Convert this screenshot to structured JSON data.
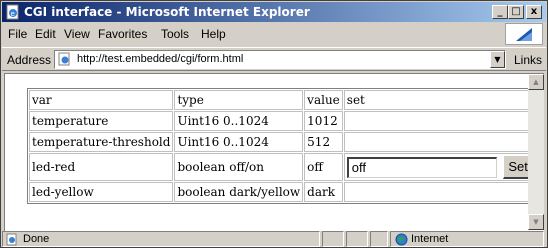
{
  "window": {
    "title": "CGI interface - Microsoft Internet Explorer",
    "minimize": "_",
    "maximize": "□",
    "close": "x"
  },
  "menu": {
    "file": "File",
    "edit": "Edit",
    "view": "View",
    "favorites": "Favorites",
    "tools": "Tools",
    "help": "Help"
  },
  "address": {
    "label": "Address",
    "url": "http://test.embedded/cgi/form.html",
    "links": "Links"
  },
  "table": {
    "headers": [
      "var",
      "type",
      "value",
      "set"
    ],
    "rows": [
      {
        "var": "temperature",
        "type": "Uint16 0..1024",
        "value": "1012"
      },
      {
        "var": "temperature-threshold",
        "type": "Uint16 0..1024",
        "value": "512"
      },
      {
        "var": "led-red",
        "type": "boolean off/on",
        "value": "off",
        "input": "off",
        "button": "Set"
      },
      {
        "var": "led-yellow",
        "type": "boolean dark/yellow",
        "value": "dark"
      }
    ]
  },
  "status": {
    "text": "Done",
    "zone": "Internet"
  },
  "colors": {
    "titlebar_start": "#0a246a",
    "titlebar_end": "#a6caf0",
    "chrome": "#d4d0c8"
  },
  "icons": [
    "ie-page-icon",
    "ie-logo-icon",
    "globe-icon",
    "chevron-down-icon",
    "scroll-up-icon",
    "scroll-down-icon"
  ]
}
